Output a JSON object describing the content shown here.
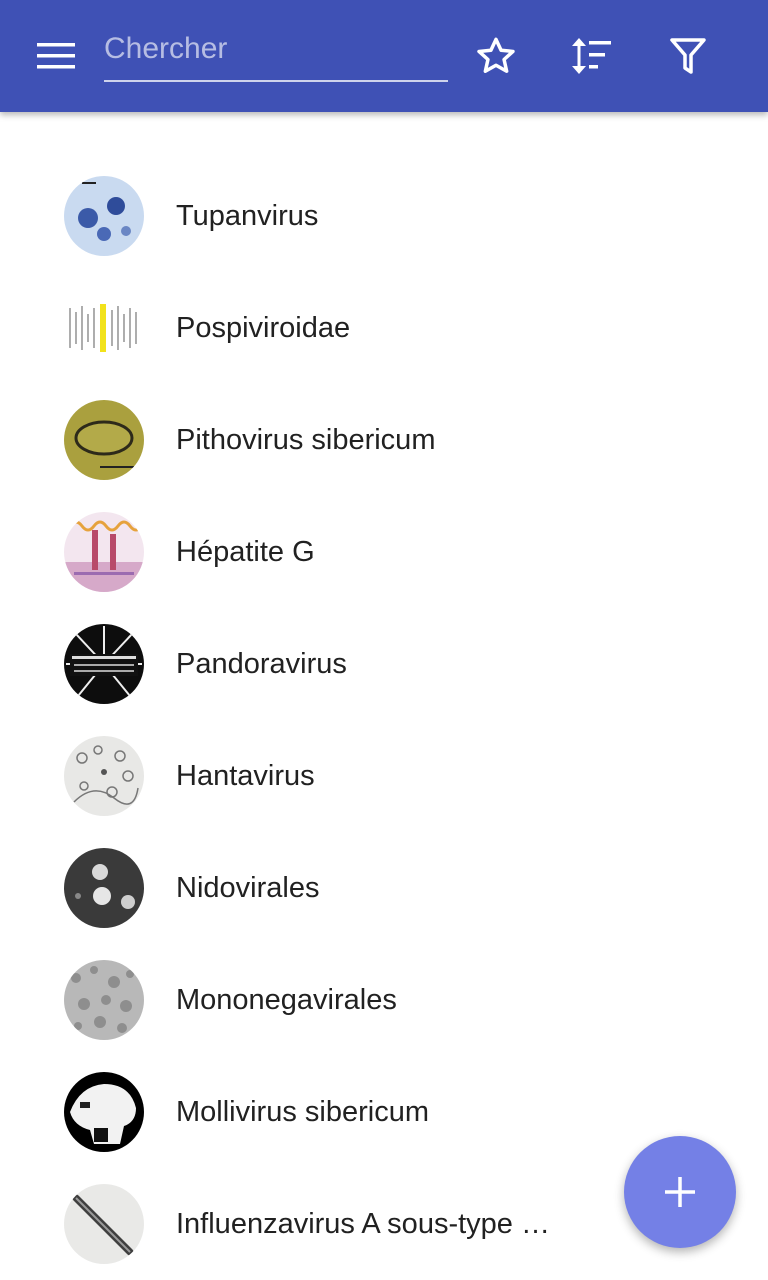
{
  "appbar": {
    "menu_icon": "hamburger-menu-icon",
    "search": {
      "placeholder": "Chercher",
      "value": ""
    },
    "actions": [
      "star-icon",
      "sort-icon",
      "filter-icon"
    ],
    "background": "#3f51b5"
  },
  "list": {
    "items": [
      {
        "label": "Tupanvirus",
        "thumb": "electron-micrograph-blue"
      },
      {
        "label": "Pospiviroidae",
        "thumb": "gel-bands"
      },
      {
        "label": "Pithovirus sibericum",
        "thumb": "olive-micrograph"
      },
      {
        "label": "Hépatite G",
        "thumb": "diagram-pink"
      },
      {
        "label": "Pandoravirus",
        "thumb": "black-poster"
      },
      {
        "label": "Hantavirus",
        "thumb": "grey-micrograph"
      },
      {
        "label": "Nidovirales",
        "thumb": "dark-micrograph"
      },
      {
        "label": "Mononegavirales",
        "thumb": "grey-texture"
      },
      {
        "label": "Mollivirus sibericum",
        "thumb": "bw-highcontrast"
      },
      {
        "label": "Influenzavirus A sous-type …",
        "thumb": "rod-micrograph"
      }
    ]
  },
  "fab": {
    "icon": "plus-icon",
    "color": "#7480e6"
  }
}
